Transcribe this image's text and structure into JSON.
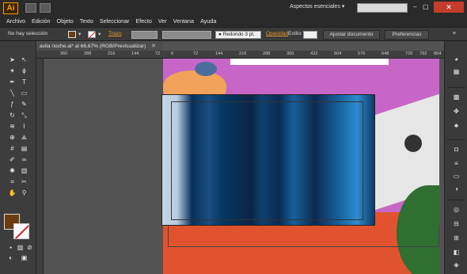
{
  "app": {
    "logo": "Ai",
    "workspace": "Aspectos esenciales",
    "colors": {
      "accent": "#ff9a00",
      "fill": "#6b3d10",
      "close": "#c43c2b"
    }
  },
  "menu": [
    "Archivo",
    "Edición",
    "Objeto",
    "Texto",
    "Seleccionar",
    "Efecto",
    "Ver",
    "Ventana",
    "Ayuda"
  ],
  "control": {
    "selection": "No hay selección",
    "stroke_label": "Trazo",
    "brush": "Redondo 3 pt.",
    "opacity_label": "Opacidad",
    "style_label": "Estilo:",
    "fit_doc": "Ajustar documento",
    "prefs": "Preferencias"
  },
  "document": {
    "tab": "avila noche.ai* al 66,67% (RGB/Previsualizar)"
  },
  "ruler": {
    "ticks": [
      "360",
      "288",
      "216",
      "144",
      "72",
      "0",
      "72",
      "144",
      "216",
      "288",
      "360",
      "432",
      "504",
      "576",
      "648",
      "720",
      "792",
      "864"
    ]
  },
  "icons": {
    "tools": [
      "selection-tool-icon",
      "direct-selection-tool-icon",
      "magic-wand-icon",
      "lasso-icon",
      "pen-tool-icon",
      "type-tool-icon",
      "line-tool-icon",
      "rectangle-tool-icon",
      "paintbrush-icon",
      "pencil-icon",
      "rotate-tool-icon",
      "scale-tool-icon",
      "width-tool-icon",
      "warp-icon",
      "shape-builder-icon",
      "perspective-icon",
      "mesh-icon",
      "gradient-icon",
      "eyedropper-icon",
      "blend-icon",
      "symbol-sprayer-icon",
      "graph-icon",
      "artboard-tool-icon",
      "slice-icon",
      "hand-tool-icon",
      "zoom-tool-icon"
    ],
    "panels": [
      "color-icon",
      "color-guide-icon",
      "swatches-icon",
      "brushes-icon",
      "symbols-icon",
      "graphic-styles-icon",
      "stroke-icon",
      "gradient-panel-icon",
      "transparency-icon",
      "appearance-icon",
      "align-icon",
      "transform-icon",
      "pathfinder-icon",
      "layers-icon",
      "artboards-icon"
    ]
  }
}
